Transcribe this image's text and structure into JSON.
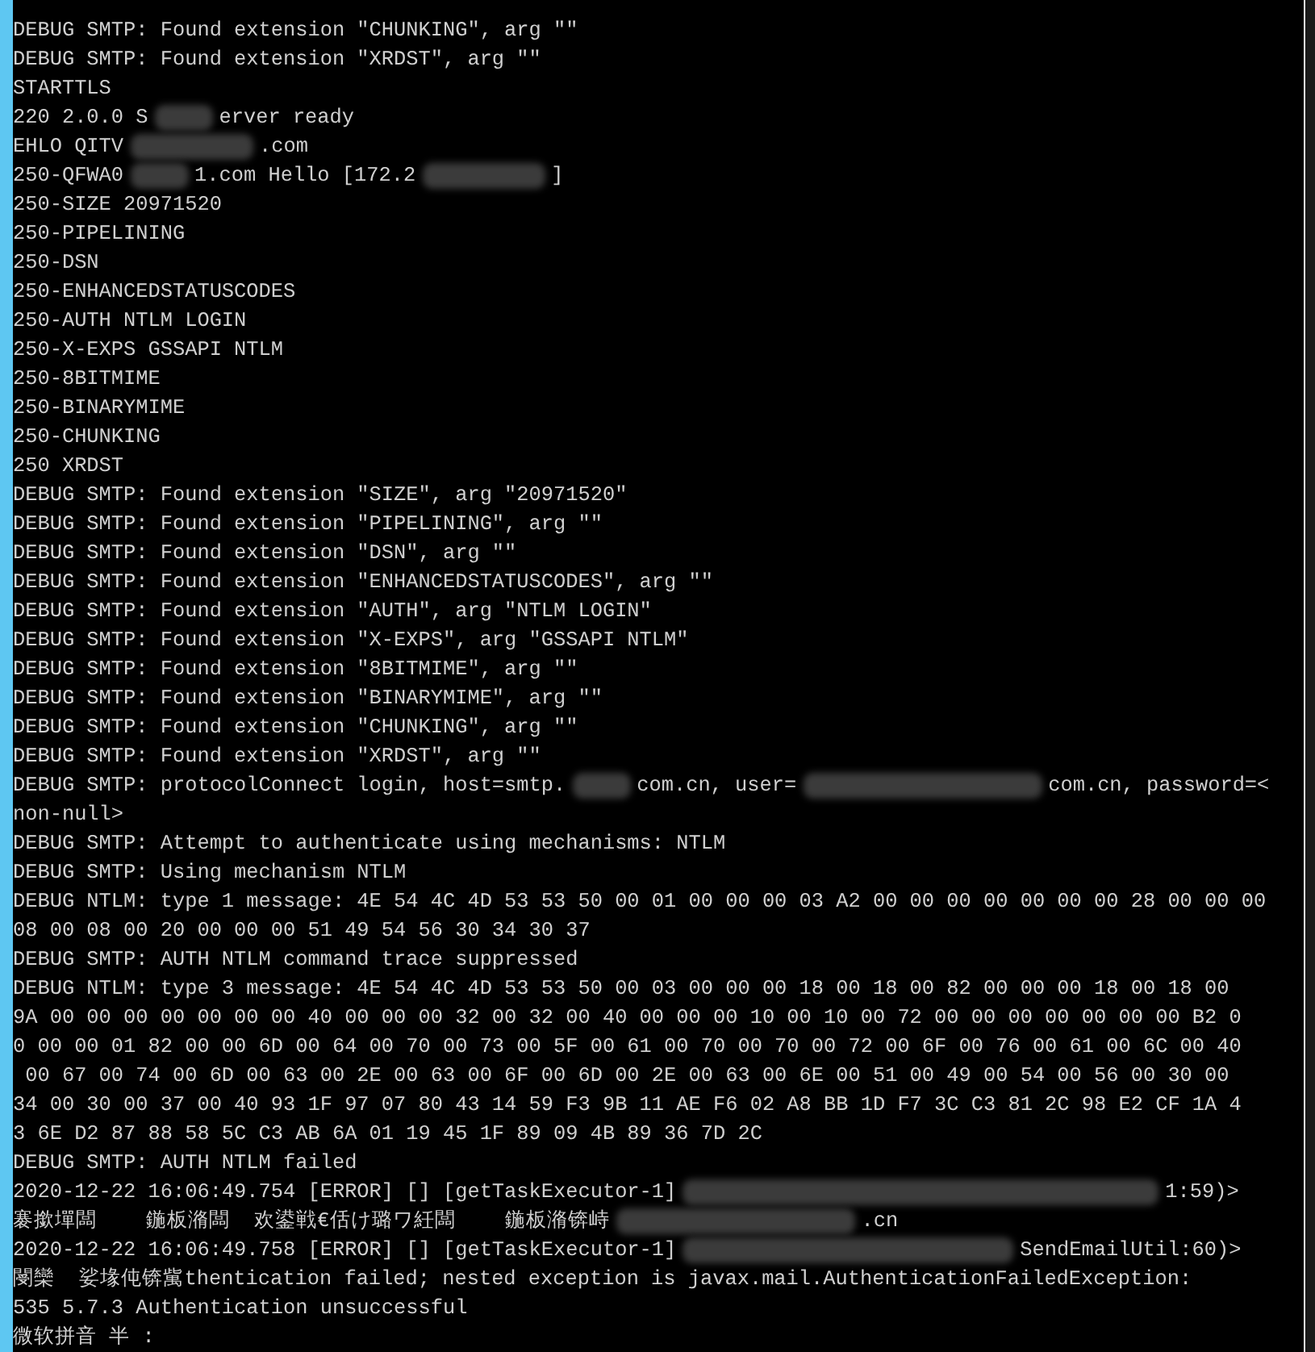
{
  "console": {
    "lines": [
      {
        "text": "DEBUG SMTP: Found extension \"CHUNKING\", arg \"\""
      },
      {
        "text": "DEBUG SMTP: Found extension \"XRDST\", arg \"\""
      },
      {
        "text": "STARTTLS"
      },
      {
        "parts": [
          {
            "kind": "text",
            "text": "220 2.0.0 S"
          },
          {
            "kind": "blur_short"
          },
          {
            "kind": "text",
            "text": "erver ready"
          }
        ]
      },
      {
        "parts": [
          {
            "kind": "text",
            "text": "EHLO QITV"
          },
          {
            "kind": "blur_medium"
          },
          {
            "kind": "text",
            "text": ".com"
          }
        ]
      },
      {
        "parts": [
          {
            "kind": "text",
            "text": "250-QFWA0"
          },
          {
            "kind": "blur_short"
          },
          {
            "kind": "text",
            "text": "1.com Hello [172.2"
          },
          {
            "kind": "blur_medium"
          },
          {
            "kind": "text",
            "text": "]"
          }
        ]
      },
      {
        "text": "250-SIZE 20971520"
      },
      {
        "text": "250-PIPELINING"
      },
      {
        "text": "250-DSN"
      },
      {
        "text": "250-ENHANCEDSTATUSCODES"
      },
      {
        "text": "250-AUTH NTLM LOGIN"
      },
      {
        "text": "250-X-EXPS GSSAPI NTLM"
      },
      {
        "text": "250-8BITMIME"
      },
      {
        "text": "250-BINARYMIME"
      },
      {
        "text": "250-CHUNKING"
      },
      {
        "text": "250 XRDST"
      },
      {
        "text": "DEBUG SMTP: Found extension \"SIZE\", arg \"20971520\""
      },
      {
        "text": "DEBUG SMTP: Found extension \"PIPELINING\", arg \"\""
      },
      {
        "text": "DEBUG SMTP: Found extension \"DSN\", arg \"\""
      },
      {
        "text": "DEBUG SMTP: Found extension \"ENHANCEDSTATUSCODES\", arg \"\""
      },
      {
        "text": "DEBUG SMTP: Found extension \"AUTH\", arg \"NTLM LOGIN\""
      },
      {
        "text": "DEBUG SMTP: Found extension \"X-EXPS\", arg \"GSSAPI NTLM\""
      },
      {
        "text": "DEBUG SMTP: Found extension \"8BITMIME\", arg \"\""
      },
      {
        "text": "DEBUG SMTP: Found extension \"BINARYMIME\", arg \"\""
      },
      {
        "text": "DEBUG SMTP: Found extension \"CHUNKING\", arg \"\""
      },
      {
        "text": "DEBUG SMTP: Found extension \"XRDST\", arg \"\""
      },
      {
        "parts": [
          {
            "kind": "text",
            "text": "DEBUG SMTP: protocolConnect login, host=smtp."
          },
          {
            "kind": "blur_short"
          },
          {
            "kind": "text",
            "text": "com.cn, user="
          },
          {
            "kind": "blur_long"
          },
          {
            "kind": "text",
            "text": "com.cn, password=<"
          }
        ]
      },
      {
        "text": "non-null>"
      },
      {
        "text": "DEBUG SMTP: Attempt to authenticate using mechanisms: NTLM"
      },
      {
        "text": "DEBUG SMTP: Using mechanism NTLM"
      },
      {
        "text": "DEBUG NTLM: type 1 message: 4E 54 4C 4D 53 53 50 00 01 00 00 00 03 A2 00 00 00 00 00 00 00 28 00 00 00"
      },
      {
        "text": "08 00 08 00 20 00 00 00 51 49 54 56 30 34 30 37"
      },
      {
        "text": "DEBUG SMTP: AUTH NTLM command trace suppressed"
      },
      {
        "text": "DEBUG NTLM: type 3 message: 4E 54 4C 4D 53 53 50 00 03 00 00 00 18 00 18 00 82 00 00 00 18 00 18 00"
      },
      {
        "text": "9A 00 00 00 00 00 00 00 40 00 00 00 32 00 32 00 40 00 00 00 10 00 10 00 72 00 00 00 00 00 00 00 B2 0"
      },
      {
        "text": "0 00 00 01 82 00 00 6D 00 64 00 70 00 73 00 5F 00 61 00 70 00 70 00 72 00 6F 00 76 00 61 00 6C 00 40"
      },
      {
        "text": " 00 67 00 74 00 6D 00 63 00 2E 00 63 00 6F 00 6D 00 2E 00 63 00 6E 00 51 00 49 00 54 00 56 00 30 00"
      },
      {
        "text": "34 00 30 00 37 00 40 93 1F 97 07 80 43 14 59 F3 9B 11 AE F6 02 A8 BB 1D F7 3C C3 81 2C 98 E2 CF 1A 4"
      },
      {
        "text": "3 6E D2 87 88 58 5C C3 AB 6A 01 19 45 1F 89 09 4B 89 36 7D 2C"
      },
      {
        "text": "DEBUG SMTP: AUTH NTLM failed"
      },
      {
        "parts": [
          {
            "kind": "text",
            "text": "2020-12-22 16:06:49.754 [ERROR] [] [getTaskExecutor-1]"
          },
          {
            "kind": "blur_xlong"
          },
          {
            "kind": "text",
            "text": "1:59)>"
          }
        ]
      },
      {
        "parts": [
          {
            "kind": "text",
            "text": "褰撳墠闆    鍦板潃闆  欢鍙戦€佸け璐ワ紝闆    鍦板潃锛峙"
          },
          {
            "kind": "blur_long"
          },
          {
            "kind": "text",
            "text": ".cn"
          }
        ]
      },
      {
        "parts": [
          {
            "kind": "text",
            "text": "2020-12-22 16:06:49.758 [ERROR] [] [getTaskExecutor-1]"
          },
          {
            "kind": "blur_wide"
          },
          {
            "kind": "text",
            "text": "SendEmailUtil:60)>"
          }
        ]
      },
      {
        "text": "閿欒  娑堟伅锛歶thentication failed; nested exception is javax.mail.AuthenticationFailedException:"
      },
      {
        "text": "535 5.7.3 Authentication unsuccessful"
      },
      {
        "text": "微软拼音 半 :"
      }
    ]
  }
}
